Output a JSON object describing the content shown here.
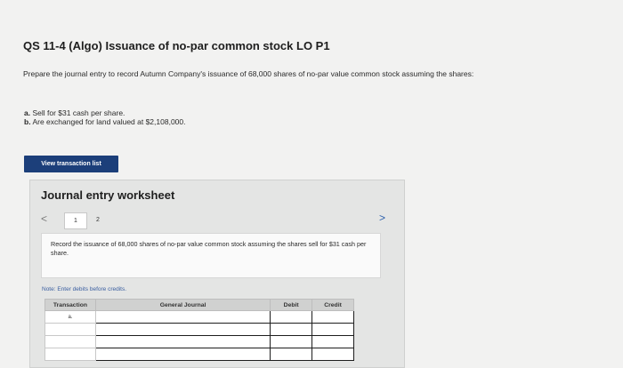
{
  "question": {
    "title": "QS 11-4 (Algo) Issuance of no-par common stock LO P1",
    "prompt": "Prepare the journal entry to record Autumn Company's issuance of 68,000 shares of no-par value common stock assuming the shares:",
    "part_a_label": "a.",
    "part_a_text": "Sell for $31 cash per share.",
    "part_b_label": "b.",
    "part_b_text": "Are exchanged for land valued at $2,108,000."
  },
  "buttons": {
    "view_transactions": "View transaction list"
  },
  "worksheet": {
    "title": "Journal entry worksheet",
    "prev": "<",
    "next": ">",
    "tabs": [
      "1",
      "2"
    ],
    "instruction": "Record the issuance of 68,000 shares of no-par value common stock assuming the shares sell for $31 cash per share.",
    "note": "Note: Enter debits before credits.",
    "columns": [
      "Transaction",
      "General Journal",
      "Debit",
      "Credit"
    ],
    "rows": [
      {
        "transaction": "a."
      },
      {
        "transaction": ""
      },
      {
        "transaction": ""
      },
      {
        "transaction": ""
      }
    ]
  }
}
